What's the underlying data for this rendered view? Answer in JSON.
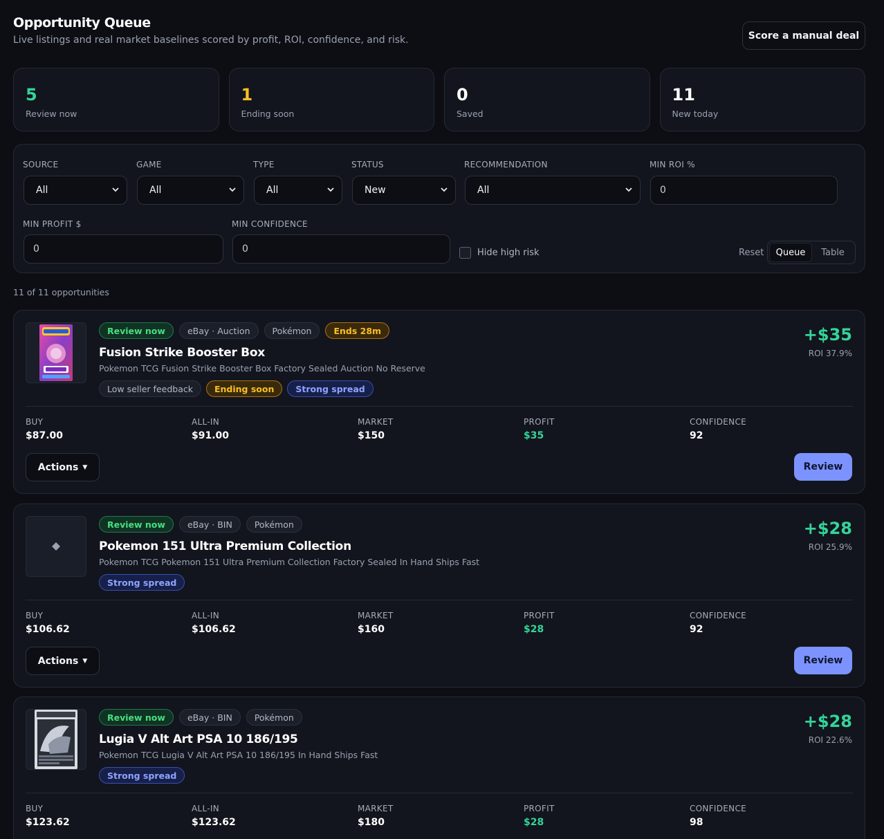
{
  "header": {
    "title": "Opportunity Queue",
    "subtitle": "Live listings and real market baselines scored by profit, ROI, confidence, and risk.",
    "manual_deal_label": "Score a manual deal"
  },
  "stats": [
    {
      "value": "5",
      "label": "Review now",
      "color": "#34d399"
    },
    {
      "value": "1",
      "label": "Ending soon",
      "color": "#fbbf24"
    },
    {
      "value": "0",
      "label": "Saved",
      "color": "#ffffff"
    },
    {
      "value": "11",
      "label": "New today",
      "color": "#ffffff"
    }
  ],
  "filters": {
    "source": {
      "label": "SOURCE",
      "value": "All"
    },
    "game": {
      "label": "GAME",
      "value": "All"
    },
    "type": {
      "label": "TYPE",
      "value": "All"
    },
    "status": {
      "label": "STATUS",
      "value": "New"
    },
    "recommendation": {
      "label": "RECOMMENDATION",
      "value": "All"
    },
    "min_roi": {
      "label": "MIN ROI %",
      "value": "0"
    },
    "min_profit": {
      "label": "MIN PROFIT $",
      "value": "0"
    },
    "min_confidence": {
      "label": "MIN CONFIDENCE",
      "value": "0"
    },
    "hide_high_risk_label": "Hide high risk",
    "reset_label": "Reset",
    "view_queue": "Queue",
    "view_table": "Table"
  },
  "count_text": "11 of 11 opportunities",
  "metric_labels": {
    "buy": "BUY",
    "all_in": "ALL-IN",
    "market": "MARKET",
    "profit": "PROFIT",
    "confidence": "CONFIDENCE"
  },
  "actions_label": "Actions",
  "review_label": "Review",
  "cards": [
    {
      "tags": [
        {
          "text": "Review now",
          "style": "green"
        },
        {
          "text": "eBay · Auction",
          "style": "gray"
        },
        {
          "text": "Pokémon",
          "style": "gray"
        },
        {
          "text": "Ends 28m",
          "style": "orange"
        }
      ],
      "title": "Fusion Strike Booster Box",
      "subtitle": "Pokemon TCG Fusion Strike Booster Box Factory Sealed Auction No Reserve",
      "flags": [
        {
          "text": "Low seller feedback",
          "style": "gray"
        },
        {
          "text": "Ending soon",
          "style": "orange"
        },
        {
          "text": "Strong spread",
          "style": "blue"
        }
      ],
      "profit_big": "+$35",
      "roi": "ROI 37.9%",
      "buy": "$87.00",
      "all_in": "$91.00",
      "market": "$150",
      "profit": "$35",
      "confidence": "92",
      "thumb": "booster-box"
    },
    {
      "tags": [
        {
          "text": "Review now",
          "style": "green"
        },
        {
          "text": "eBay · BIN",
          "style": "gray"
        },
        {
          "text": "Pokémon",
          "style": "gray"
        }
      ],
      "title": "Pokemon 151 Ultra Premium Collection",
      "subtitle": "Pokemon TCG Pokemon 151 Ultra Premium Collection Factory Sealed In Hand Ships Fast",
      "flags": [
        {
          "text": "Strong spread",
          "style": "blue"
        }
      ],
      "profit_big": "+$28",
      "roi": "ROI 25.9%",
      "buy": "$106.62",
      "all_in": "$106.62",
      "market": "$160",
      "profit": "$28",
      "confidence": "92",
      "thumb": "placeholder-diamond"
    },
    {
      "tags": [
        {
          "text": "Review now",
          "style": "green"
        },
        {
          "text": "eBay · BIN",
          "style": "gray"
        },
        {
          "text": "Pokémon",
          "style": "gray"
        }
      ],
      "title": "Lugia V Alt Art PSA 10 186/195",
      "subtitle": "Pokemon TCG Lugia V Alt Art PSA 10 186/195 In Hand Ships Fast",
      "flags": [
        {
          "text": "Strong spread",
          "style": "blue"
        }
      ],
      "profit_big": "+$28",
      "roi": "ROI 22.6%",
      "buy": "$123.62",
      "all_in": "$123.62",
      "market": "$180",
      "profit": "$28",
      "confidence": "98",
      "thumb": "graded-card"
    }
  ]
}
